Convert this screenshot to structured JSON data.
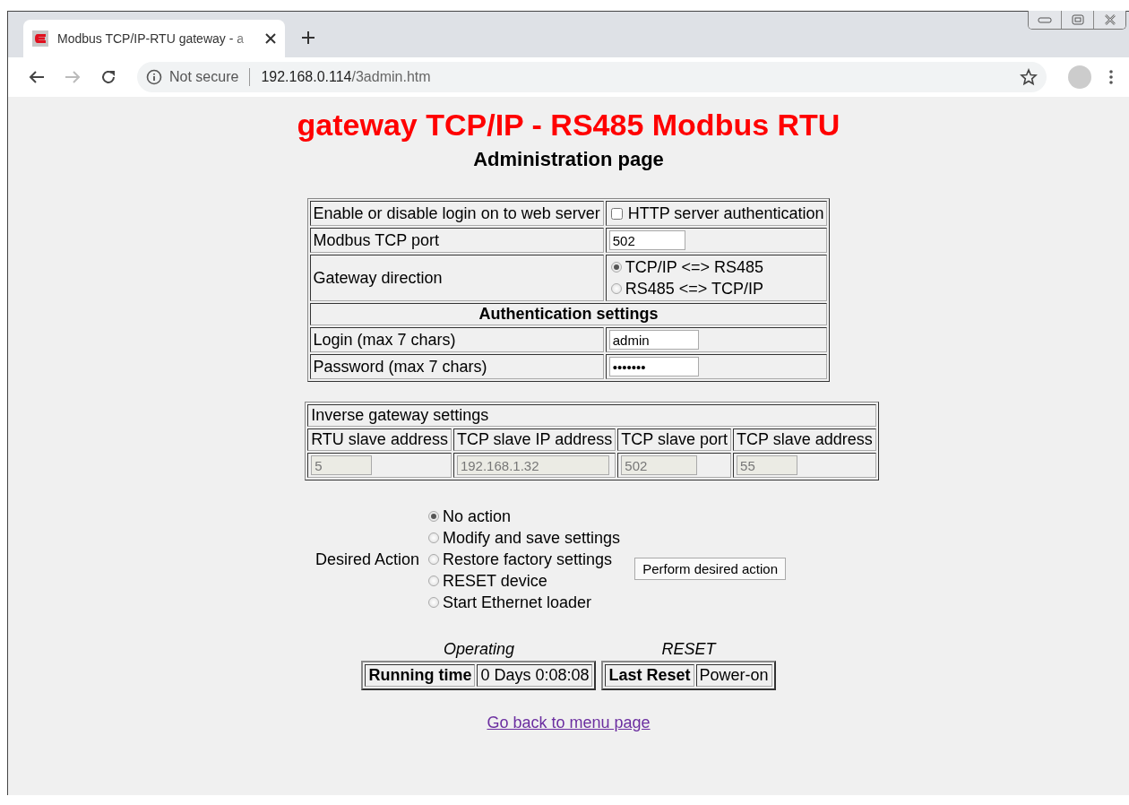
{
  "browser": {
    "tab": {
      "title": "Modbus TCP/IP-RTU gateway - a"
    },
    "address": {
      "security": "Not secure",
      "host": "192.168.0.114",
      "path": "/3admin.htm"
    }
  },
  "page": {
    "title": "gateway TCP/IP - RS485 Modbus RTU",
    "subtitle": "Administration page",
    "settings": [
      {
        "kind": "checkbox",
        "label": "Enable or disable login on to web server",
        "option": "HTTP server authentication",
        "checked": false
      },
      {
        "kind": "text",
        "label": "Modbus TCP port",
        "value": "502"
      },
      {
        "kind": "radios",
        "label": "Gateway direction",
        "options": [
          {
            "label": "TCP/IP <=> RS485",
            "selected": true
          },
          {
            "label": "RS485 <=> TCP/IP",
            "selected": false
          }
        ]
      },
      {
        "kind": "header",
        "label": "Authentication settings"
      },
      {
        "kind": "text",
        "label": "Login (max 7 chars)",
        "value": "admin"
      },
      {
        "kind": "text",
        "label": "Password (max 7 chars)",
        "value": "•••••••"
      }
    ],
    "inverse": {
      "title": "Inverse gateway settings",
      "columns": [
        "RTU slave address",
        "TCP slave IP address",
        "TCP slave port",
        "TCP slave address"
      ],
      "values": [
        "5",
        "192.168.1.32",
        "502",
        "55"
      ],
      "disabled": true
    },
    "action": {
      "label": "Desired Action",
      "options": [
        {
          "label": "No action",
          "selected": true
        },
        {
          "label": "Modify and save settings",
          "selected": false
        },
        {
          "label": "Restore factory settings",
          "selected": false
        },
        {
          "label": "RESET device",
          "selected": false
        },
        {
          "label": "Start Ethernet loader",
          "selected": false
        }
      ],
      "button": "Perform desired action"
    },
    "status": [
      {
        "caption": "Operating",
        "name": "Running time",
        "value": "0 Days 0:08:08"
      },
      {
        "caption": "RESET",
        "name": "Last Reset",
        "value": "Power-on"
      }
    ],
    "link": "Go back to menu page"
  }
}
